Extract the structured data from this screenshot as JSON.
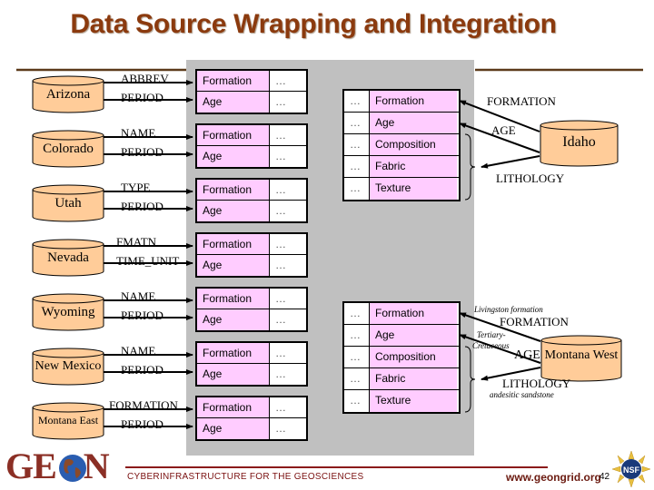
{
  "title": "Data Source Wrapping and Integration",
  "colors": {
    "title": "#8b3a0e",
    "cylinder_fill": "#ffcc99",
    "table_pink": "#ffccff",
    "panel_gray": "#c0c0c0",
    "rule_brown": "#5c3a1a",
    "footer_red": "#8b1a1a"
  },
  "sources": [
    {
      "name": "Arizona",
      "fields": [
        "ABBREV",
        "PERIOD"
      ],
      "table": [
        [
          "Formation",
          "…"
        ],
        [
          "Age",
          "…"
        ]
      ]
    },
    {
      "name": "Colorado",
      "fields": [
        "NAME",
        "PERIOD"
      ],
      "table": [
        [
          "Formation",
          "…"
        ],
        [
          "Age",
          "…"
        ]
      ]
    },
    {
      "name": "Utah",
      "fields": [
        "TYPE",
        "PERIOD"
      ],
      "table": [
        [
          "Formation",
          "…"
        ],
        [
          "Age",
          "…"
        ]
      ]
    },
    {
      "name": "Nevada",
      "fields": [
        "FMATN",
        "TIME_UNIT"
      ],
      "table": [
        [
          "Formation",
          "…"
        ],
        [
          "Age",
          "…"
        ]
      ]
    },
    {
      "name": "Wyoming",
      "fields": [
        "NAME",
        "PERIOD"
      ],
      "table": [
        [
          "Formation",
          "…"
        ],
        [
          "Age",
          "…"
        ]
      ]
    },
    {
      "name": "New Mexico",
      "fields": [
        "NAME",
        "PERIOD"
      ],
      "table": [
        [
          "Formation",
          "…"
        ],
        [
          "Age",
          "…"
        ]
      ]
    },
    {
      "name": "Montana East",
      "fields": [
        "FORMATION",
        "PERIOD"
      ],
      "table": [
        [
          "Formation",
          "…"
        ],
        [
          "Age",
          "…"
        ]
      ]
    }
  ],
  "right_tables": [
    {
      "rows": [
        [
          "…",
          "Formation"
        ],
        [
          "…",
          "Age"
        ],
        [
          "…",
          "Composition"
        ],
        [
          "…",
          "Fabric"
        ],
        [
          "…",
          "Texture"
        ]
      ],
      "source": {
        "name": "Idaho",
        "labels": [
          "FORMATION",
          "AGE",
          "LITHOLOGY"
        ]
      }
    },
    {
      "rows": [
        [
          "…",
          "Formation"
        ],
        [
          "…",
          "Age"
        ],
        [
          "…",
          "Composition"
        ],
        [
          "…",
          "Fabric"
        ],
        [
          "…",
          "Texture"
        ]
      ],
      "source": {
        "name": "Montana West",
        "labels": [
          "FORMATION",
          "AGE",
          "LITHOLOGY"
        ],
        "examples": {
          "formation": "Livingston formation",
          "age_line1": "Tertiary-",
          "age_line2": "Cretaceous",
          "lithology": "andesitic sandstone"
        }
      }
    }
  ],
  "footer": {
    "logo": "GE N",
    "tagline": "CYBERINFRASTRUCTURE FOR THE GEOSCIENCES",
    "url": "www.geongrid.org",
    "page_number": "42",
    "nsf_label": "NSF"
  }
}
